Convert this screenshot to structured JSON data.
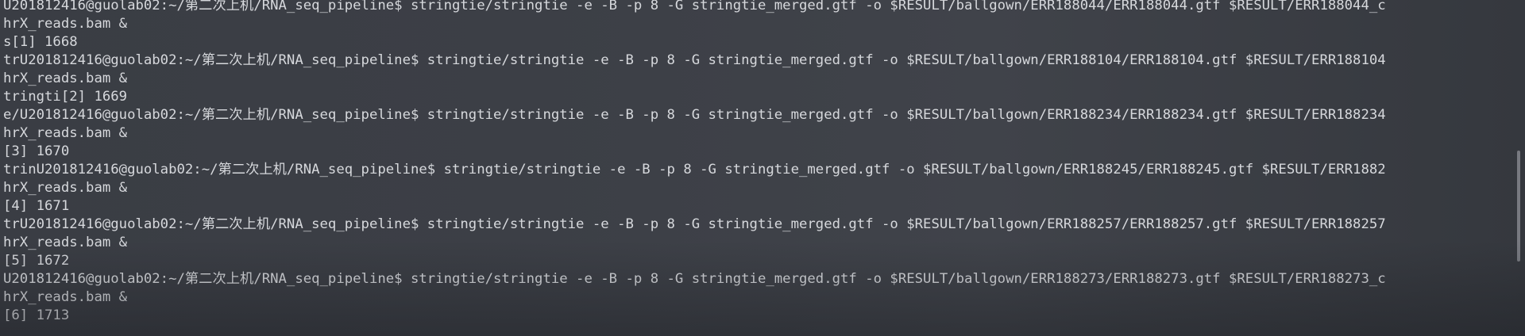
{
  "terminal": {
    "top_partial": "",
    "lines": [
      "U201812416@guolab02:~/第二次上机/RNA_seq_pipeline$ stringtie/stringtie -e -B -p 8 -G stringtie_merged.gtf -o $RESULT/ballgown/ERR188044/ERR188044.gtf $RESULT/ERR188044_c",
      "hrX_reads.bam &",
      "s[1] 1668",
      "trU201812416@guolab02:~/第二次上机/RNA_seq_pipeline$ stringtie/stringtie -e -B -p 8 -G stringtie_merged.gtf -o $RESULT/ballgown/ERR188104/ERR188104.gtf $RESULT/ERR188104",
      "hrX_reads.bam &",
      "tringti[2] 1669",
      "e/U201812416@guolab02:~/第二次上机/RNA_seq_pipeline$ stringtie/stringtie -e -B -p 8 -G stringtie_merged.gtf -o $RESULT/ballgown/ERR188234/ERR188234.gtf $RESULT/ERR188234",
      "hrX_reads.bam &",
      "[3] 1670",
      "trinU201812416@guolab02:~/第二次上机/RNA_seq_pipeline$ stringtie/stringtie -e -B -p 8 -G stringtie_merged.gtf -o $RESULT/ballgown/ERR188245/ERR188245.gtf $RESULT/ERR1882",
      "hrX_reads.bam &",
      "[4] 1671",
      "trU201812416@guolab02:~/第二次上机/RNA_seq_pipeline$ stringtie/stringtie -e -B -p 8 -G stringtie_merged.gtf -o $RESULT/ballgown/ERR188257/ERR188257.gtf $RESULT/ERR188257",
      "hrX_reads.bam &",
      "[5] 1672",
      "U201812416@guolab02:~/第二次上机/RNA_seq_pipeline$ stringtie/stringtie -e -B -p 8 -G stringtie_merged.gtf -o $RESULT/ballgown/ERR188273/ERR188273.gtf $RESULT/ERR188273_c",
      "hrX_reads.bam &",
      "[6] 1713"
    ]
  },
  "colors": {
    "background": "#3b3e45",
    "text": "#d6d8dc"
  }
}
